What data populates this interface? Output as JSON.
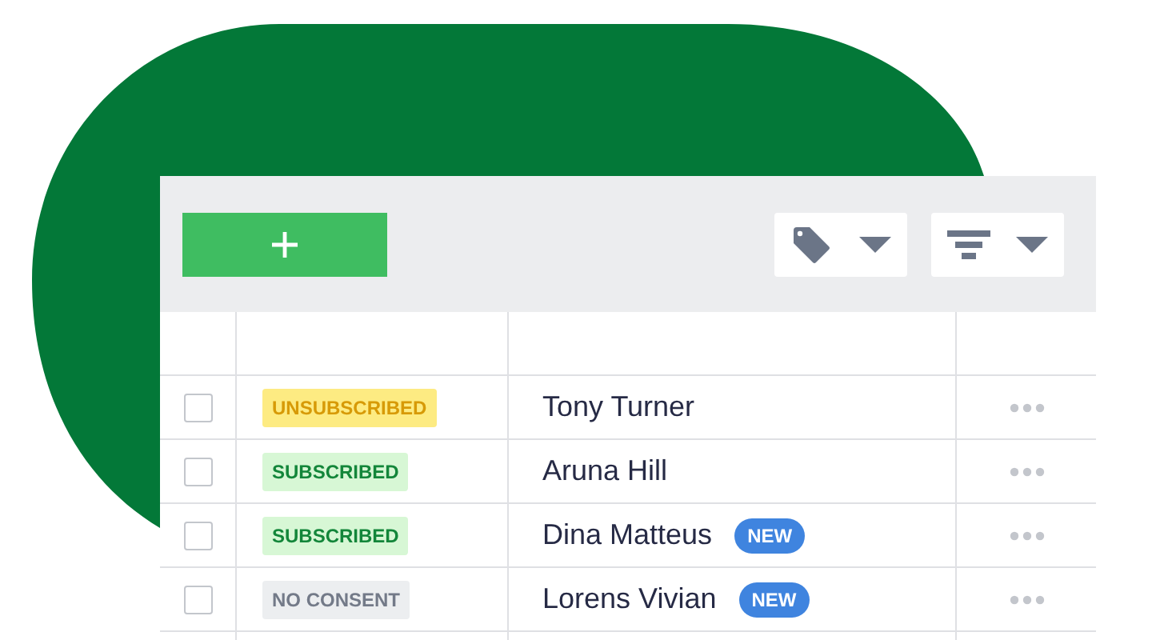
{
  "toolbar": {
    "add_button": {
      "kind": "plus"
    },
    "dropdowns": [
      {
        "kind": "tag"
      },
      {
        "kind": "filter"
      }
    ]
  },
  "table": {
    "rows": [
      {
        "checked": false,
        "status": {
          "label": "UNSUBSCRIBED",
          "kind": "unsubscribed"
        },
        "name": "Tony Turner"
      },
      {
        "checked": false,
        "status": {
          "label": "SUBSCRIBED",
          "kind": "subscribed"
        },
        "name": "Aruna Hill"
      },
      {
        "checked": false,
        "status": {
          "label": "SUBSCRIBED",
          "kind": "subscribed"
        },
        "name": "Dina Matteus",
        "badge": "NEW"
      },
      {
        "checked": false,
        "status": {
          "label": "NO CONSENT",
          "kind": "no_consent"
        },
        "name": "Lorens Vivian",
        "badge": "NEW"
      }
    ]
  }
}
